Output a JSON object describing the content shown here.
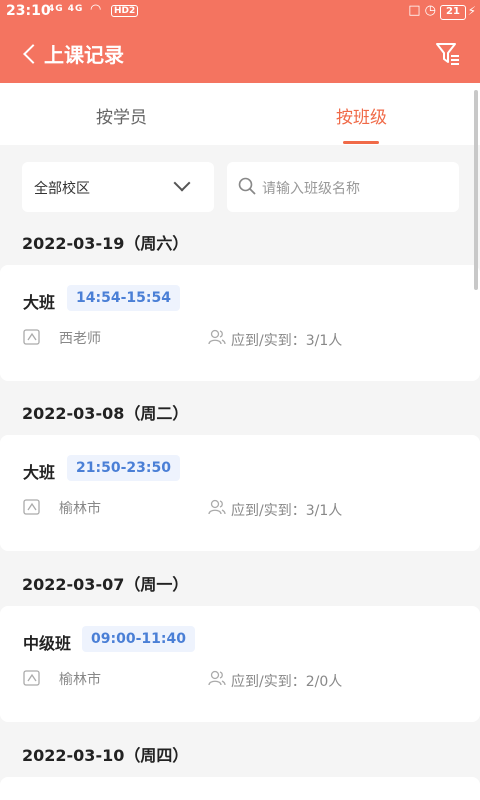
{
  "status_bar": {
    "time": "23:10",
    "network": "4G 4G",
    "hd": "HD2",
    "battery": "21"
  },
  "nav": {
    "title": "上课记录"
  },
  "tabs": [
    {
      "label": "按学员",
      "active": false
    },
    {
      "label": "按班级",
      "active": true
    }
  ],
  "filters": {
    "campus_select": "全部校区",
    "search_placeholder": "请输入班级名称"
  },
  "records": [
    {
      "date": "2022-03-19（周六）",
      "class_name": "大班",
      "time": "14:54-15:54",
      "teacher": "西老师",
      "attendance": "应到/实到：3/1人"
    },
    {
      "date": "2022-03-08（周二）",
      "class_name": "大班",
      "time": "21:50-23:50",
      "teacher": "榆林市",
      "attendance": "应到/实到：3/1人"
    },
    {
      "date": "2022-03-07（周一）",
      "class_name": "中级班",
      "time": "09:00-11:40",
      "teacher": "榆林市",
      "attendance": "应到/实到：2/0人"
    },
    {
      "date": "2022-03-10（周四）"
    }
  ],
  "colors": {
    "brand": "#f47460",
    "accent": "#f06a48",
    "badge_text": "#4a7fd6",
    "badge_bg": "#eef3fd"
  }
}
